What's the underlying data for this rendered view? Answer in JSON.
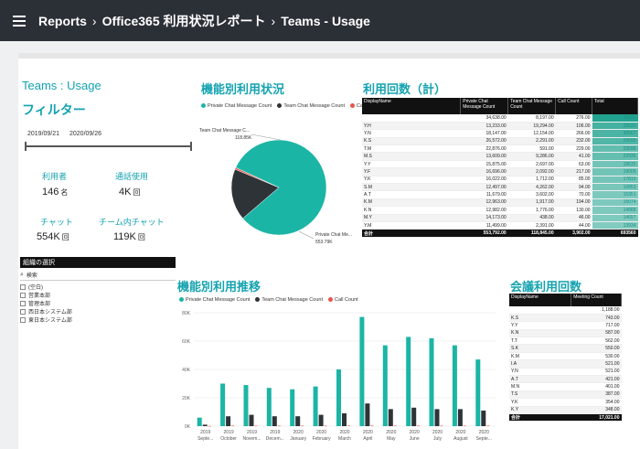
{
  "header": {
    "crumbs": [
      "Reports",
      "Office365 利用状況レポート",
      "Teams - Usage"
    ]
  },
  "page": {
    "title": "Teams : Usage",
    "filter_title": "フィルター",
    "date_from": "2019/09/21",
    "date_to": "2020/09/26"
  },
  "kpis": [
    {
      "label": "利用者",
      "value": "146",
      "unit": "名"
    },
    {
      "label": "通話使用",
      "value": "4K",
      "unit": "回"
    },
    {
      "label": "チャット",
      "value": "554K",
      "unit": "回"
    },
    {
      "label": "チーム内チャット",
      "value": "119K",
      "unit": "回"
    }
  ],
  "org": {
    "title": "組織の選択",
    "search_placeholder": "検索",
    "items": [
      "(空白)",
      "営業本部",
      "管理本部",
      "西日本システム部",
      "東日本システム部"
    ]
  },
  "pie": {
    "title": "機能別利用状況",
    "legend": [
      "Private Chat Message Count",
      "Team Chat Message Count",
      "Call Count"
    ],
    "colors": [
      "#1bb5a5",
      "#2e3338",
      "#e8534d"
    ],
    "values": [
      553.79,
      118.85,
      3.9
    ],
    "label_team": "Team Chat Message C...",
    "label_team_val": "118.85K",
    "label_private": "Private Chat Me...",
    "label_private_val": "553.79K"
  },
  "usage_table": {
    "title": "利用回数（計）",
    "headers": [
      "DisplayName",
      "Private Chat Message Count",
      "Team Chat Message Count",
      "Call Count",
      "Total"
    ],
    "rows": [
      [
        "",
        "34,638.00",
        "8,197.00",
        "276.00",
        "43111"
      ],
      [
        "Y.H",
        "13,233.00",
        "19,294.00",
        "106.00",
        "32633"
      ],
      [
        "Y.N",
        "18,147.00",
        "12,154.00",
        "266.00",
        "30567"
      ],
      [
        "K.S",
        "26,572.00",
        "2,291.00",
        "232.00",
        "29095"
      ],
      [
        "T.M",
        "22,876.00",
        "591.00",
        "229.00",
        "23696"
      ],
      [
        "M.S",
        "13,609.00",
        "9,286.00",
        "41.00",
        "22936"
      ],
      [
        "Y.Y",
        "15,875.00",
        "2,697.00",
        "63.00",
        "18635"
      ],
      [
        "Y.F",
        "16,696.00",
        "2,092.00",
        "217.00",
        "19005"
      ],
      [
        "Y.K",
        "16,022.00",
        "1,712.00",
        "85.00",
        "17819"
      ],
      [
        "S.M",
        "12,497.00",
        "4,262.00",
        "94.00",
        "16853"
      ],
      [
        "A.T",
        "11,679.00",
        "3,602.00",
        "70.00",
        "15351"
      ],
      [
        "K.M",
        "12,963.00",
        "1,917.00",
        "194.00",
        "15074"
      ],
      [
        "K.N",
        "12,982.00",
        "1,776.00",
        "130.00",
        "14888"
      ],
      [
        "M.Y",
        "14,173.00",
        "438.00",
        "46.00",
        "14657"
      ],
      [
        "Y.M",
        "11,499.00",
        "2,391.00",
        "44.00",
        "13934"
      ]
    ],
    "total": [
      "合計",
      "553,792.00",
      "118,845.00",
      "3,902.00",
      "693560"
    ]
  },
  "bar_chart": {
    "title": "機能別利用推移",
    "legend": [
      "Private Chat Message Count",
      "Team Chat Message Count",
      "Call Count"
    ],
    "colors": [
      "#1bb5a5",
      "#2e3338",
      "#e8534d"
    ],
    "y_ticks": [
      "0K",
      "20K",
      "40K",
      "60K",
      "80K"
    ]
  },
  "chart_data": {
    "type": "bar",
    "categories": [
      "2019 Septe...",
      "2019 October",
      "2019 Novem...",
      "2019 Decem...",
      "2020 January",
      "2020 February",
      "2020 March",
      "2020 April",
      "2020 May",
      "2020 June",
      "2020 July",
      "2020 August",
      "2020 Septe..."
    ],
    "series": [
      {
        "name": "Private Chat Message Count",
        "values": [
          6,
          30,
          29,
          27,
          26,
          28,
          40,
          77,
          57,
          63,
          62,
          57,
          47
        ]
      },
      {
        "name": "Team Chat Message Count",
        "values": [
          1,
          7,
          8,
          7,
          7,
          8,
          9,
          16,
          12,
          13,
          12,
          12,
          11
        ]
      },
      {
        "name": "Call Count",
        "values": [
          0.2,
          0.3,
          0.3,
          0.3,
          0.3,
          0.3,
          0.4,
          0.4,
          0.3,
          0.3,
          0.3,
          0.3,
          0.3
        ]
      }
    ],
    "ylim": [
      0,
      80
    ]
  },
  "meeting_table": {
    "title": "会議利用回数",
    "headers": [
      "DisplayName",
      "Meeting Count"
    ],
    "rows": [
      [
        "",
        "1,188.00"
      ],
      [
        "K.S",
        "743.00"
      ],
      [
        "Y.Y",
        "717.00"
      ],
      [
        "K.N",
        "587.00"
      ],
      [
        "T.T",
        "562.00"
      ],
      [
        "S.K",
        "550.00"
      ],
      [
        "K.M",
        "530.00"
      ],
      [
        "I.A",
        "521.00"
      ],
      [
        "Y.N",
        "521.00"
      ],
      [
        "A.T",
        "421.00"
      ],
      [
        "M.N",
        "401.00"
      ],
      [
        "T.S",
        "387.00"
      ],
      [
        "Y.K",
        "354.00"
      ],
      [
        "K.Y",
        "348.00"
      ]
    ],
    "total": [
      "合計",
      "17,021.00"
    ]
  }
}
